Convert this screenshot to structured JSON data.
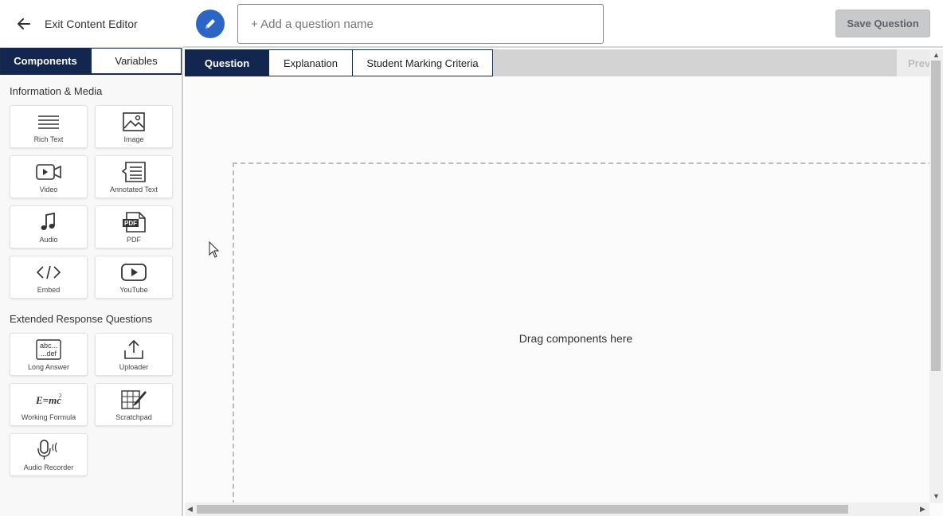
{
  "header": {
    "exit_label": "Exit Content Editor",
    "question_name_placeholder": "+ Add a question name",
    "question_name_value": "",
    "save_label": "Save Question"
  },
  "sidebar": {
    "tabs": [
      {
        "label": "Components",
        "active": true
      },
      {
        "label": "Variables",
        "active": false
      }
    ],
    "sections": [
      {
        "title": "Information & Media",
        "items": [
          {
            "label": "Rich Text",
            "icon": "rich-text-icon"
          },
          {
            "label": "Image",
            "icon": "image-icon"
          },
          {
            "label": "Video",
            "icon": "video-icon"
          },
          {
            "label": "Annotated Text",
            "icon": "annotated-text-icon"
          },
          {
            "label": "Audio",
            "icon": "audio-icon"
          },
          {
            "label": "PDF",
            "icon": "pdf-icon"
          },
          {
            "label": "Embed",
            "icon": "embed-icon"
          },
          {
            "label": "YouTube",
            "icon": "youtube-icon"
          }
        ]
      },
      {
        "title": "Extended Response Questions",
        "items": [
          {
            "label": "Long Answer",
            "icon": "long-answer-icon"
          },
          {
            "label": "Uploader",
            "icon": "uploader-icon"
          },
          {
            "label": "Working Formula",
            "icon": "working-formula-icon"
          },
          {
            "label": "Scratchpad",
            "icon": "scratchpad-icon"
          },
          {
            "label": "Audio Recorder",
            "icon": "audio-recorder-icon"
          }
        ]
      }
    ]
  },
  "main": {
    "tabs": [
      {
        "label": "Question",
        "active": true
      },
      {
        "label": "Explanation",
        "active": false
      },
      {
        "label": "Student Marking Criteria",
        "active": false
      }
    ],
    "preview_label": "Prev",
    "dropzone_text": "Drag components here"
  },
  "colors": {
    "navy": "#13264f",
    "edit_blue": "#2b66c7",
    "save_disabled": "#c8c9cb"
  }
}
